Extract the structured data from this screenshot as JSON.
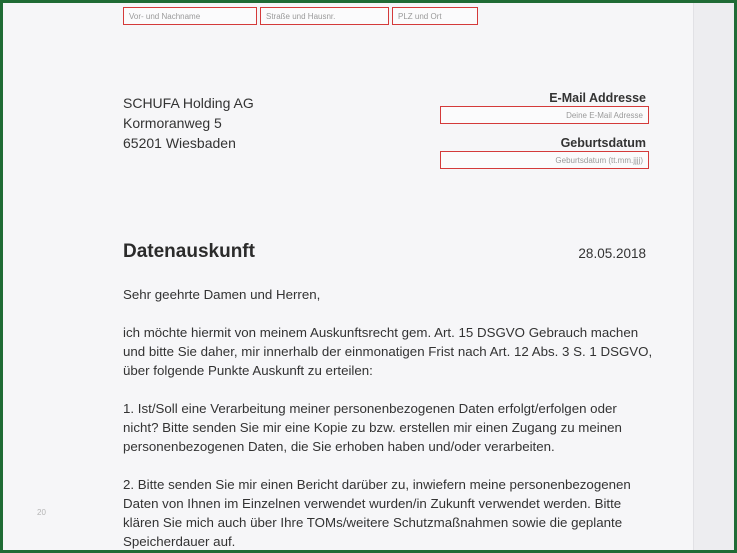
{
  "sender_fields": {
    "name_placeholder": "Vor- und Nachname",
    "street_placeholder": "Straße und Hausnr.",
    "city_placeholder": "PLZ und Ort"
  },
  "recipient": {
    "line1": "SCHUFA Holding AG",
    "line2": "Kormoranweg 5",
    "line3": "65201 Wiesbaden"
  },
  "email": {
    "label": "E-Mail Addresse",
    "placeholder": "Deine E-Mail Adresse"
  },
  "birthdate": {
    "label": "Geburtsdatum",
    "placeholder": "Geburtsdatum (tt.mm.jjjj)"
  },
  "letter": {
    "title": "Datenauskunft",
    "date": "28.05.2018",
    "greeting": "Sehr geehrte Damen und Herren,",
    "paragraphs": [
      "ich möchte hiermit von meinem Auskunftsrecht gem. Art. 15 DSGVO Gebrauch machen und bitte Sie daher, mir innerhalb der einmonatigen Frist nach Art. 12 Abs. 3 S. 1 DSGVO, über folgende Punkte Auskunft zu erteilen:",
      "1. Ist/Soll eine Verarbeitung meiner personenbezogenen Daten erfolgt/erfolgen oder nicht? Bitte senden Sie mir eine Kopie zu bzw. erstellen mir einen Zugang zu meinen personenbezogenen Daten, die Sie erhoben haben und/oder verarbeiten.",
      "2. Bitte senden Sie mir einen Bericht darüber zu, inwiefern meine personenbezogenen Daten von Ihnen im Einzelnen verwendet wurden/in Zukunft verwendet werden. Bitte klären Sie mich auch über Ihre TOMs/weitere Schutzmaßnahmen sowie die geplante Speicherdauer auf."
    ]
  },
  "page_number": "20"
}
